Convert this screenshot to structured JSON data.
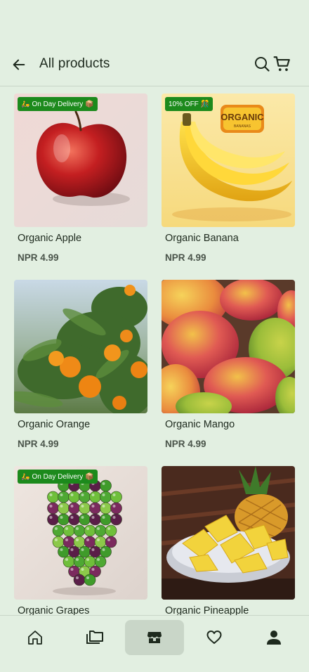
{
  "header": {
    "title": "All products",
    "back_icon": "arrow-left-icon",
    "search_icon": "search-icon",
    "cart_icon": "cart-icon"
  },
  "products": [
    {
      "name": "Organic Apple",
      "price": "NPR 4.99",
      "badge": "On Day Delivery",
      "badge_emoji_left": "🛵",
      "badge_emoji_right": "📦",
      "image": "apple"
    },
    {
      "name": "Organic Banana",
      "price": "NPR 4.99",
      "badge": "10% OFF",
      "badge_emoji_right": "🎊",
      "image": "banana",
      "image_text": "ORGANIC",
      "image_subtext": "BANANAS"
    },
    {
      "name": "Organic Orange",
      "price": "NPR 4.99",
      "image": "orange"
    },
    {
      "name": "Organic Mango",
      "price": "NPR 4.99",
      "image": "mango"
    },
    {
      "name": "Organic Grapes",
      "price": "",
      "badge": "On Day Delivery",
      "badge_emoji_left": "🛵",
      "badge_emoji_right": "📦",
      "image": "grapes"
    },
    {
      "name": "Organic Pineapple",
      "price": "",
      "image": "pineapple"
    }
  ],
  "bottom_nav": {
    "items": [
      {
        "icon": "home-icon"
      },
      {
        "icon": "categories-icon"
      },
      {
        "icon": "store-icon",
        "active": true
      },
      {
        "icon": "heart-icon"
      },
      {
        "icon": "profile-icon"
      }
    ]
  },
  "colors": {
    "background": "#e2efe1",
    "badge": "#1c8a1c",
    "active_nav": "#c9d6c8"
  }
}
